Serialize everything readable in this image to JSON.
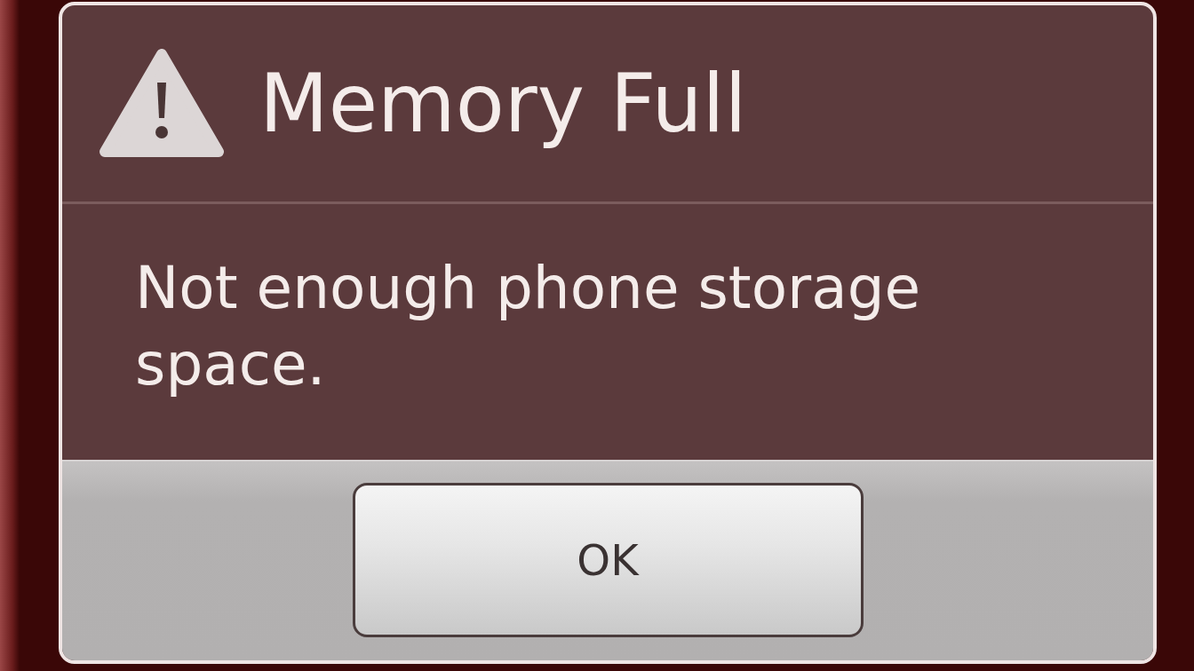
{
  "dialog": {
    "title": "Memory Full",
    "message": "Not enough phone storage space.",
    "buttons": [
      "OK"
    ]
  }
}
